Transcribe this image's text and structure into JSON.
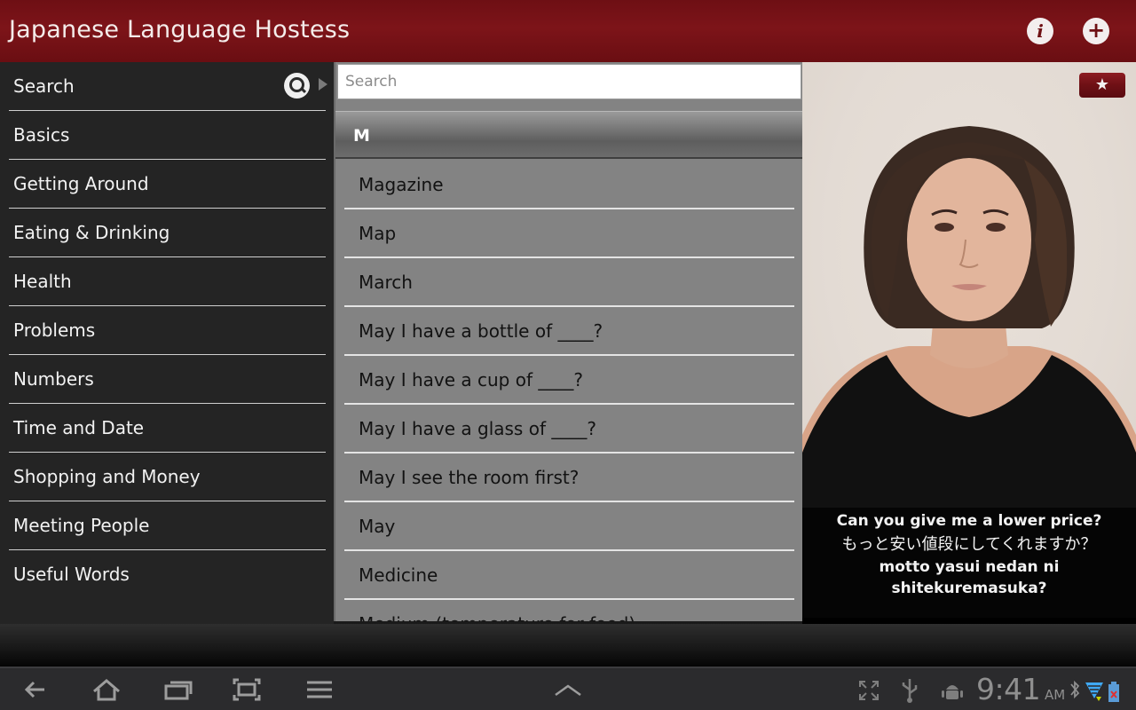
{
  "app": {
    "title": "Japanese Language Hostess",
    "info_icon": "i",
    "add_icon": "+"
  },
  "sidebar": {
    "items": [
      {
        "label": "Search",
        "icon": "search-icon"
      },
      {
        "label": "Basics"
      },
      {
        "label": "Getting Around"
      },
      {
        "label": "Eating & Drinking"
      },
      {
        "label": "Health"
      },
      {
        "label": "Problems"
      },
      {
        "label": "Numbers"
      },
      {
        "label": "Time and Date"
      },
      {
        "label": "Shopping and Money"
      },
      {
        "label": "Meeting People"
      },
      {
        "label": "Useful Words"
      }
    ]
  },
  "list": {
    "search_placeholder": "Search",
    "search_value": "",
    "section_letter": "M",
    "items": [
      "Magazine",
      "Map",
      "March",
      "May I have a bottle of ____?",
      "May I have a cup of ____?",
      "May I have a glass of ____?",
      "May I see the room first?",
      "May",
      "Medicine",
      "Medium (temperature for food)"
    ]
  },
  "video": {
    "favorite_icon": "★",
    "caption_english": "Can you give me a lower price?",
    "caption_japanese": "もっと安い値段にしてくれますか？",
    "caption_romaji": "motto yasui nedan ni shitekuremasuka?"
  },
  "system_bar": {
    "time": "9:41",
    "ampm": "AM",
    "colors": {
      "wifi": "#3fa9f5",
      "battery_alert": "#e03030"
    }
  }
}
